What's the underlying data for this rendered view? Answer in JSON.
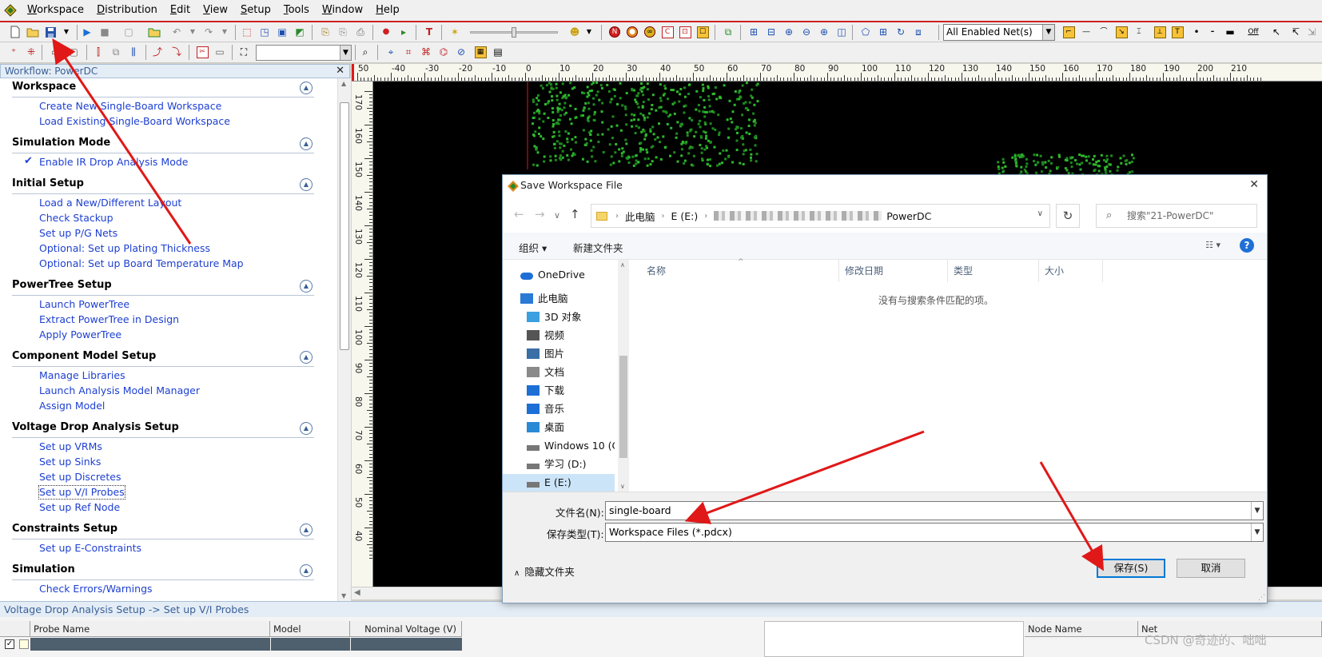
{
  "menubar": {
    "items": [
      {
        "label": "Workspace",
        "u": "W"
      },
      {
        "label": "Distribution",
        "u": "D"
      },
      {
        "label": "Edit",
        "u": "E"
      },
      {
        "label": "View",
        "u": "V"
      },
      {
        "label": "Setup",
        "u": "S"
      },
      {
        "label": "Tools",
        "u": "T"
      },
      {
        "label": "Window",
        "u": "W"
      },
      {
        "label": "Help",
        "u": "H"
      }
    ]
  },
  "toolbar": {
    "net_filter": "All Enabled Net(s)",
    "off_label": "Off"
  },
  "workflow": {
    "title": "Workflow: PowerDC",
    "sections": [
      {
        "title": "Workspace",
        "items": [
          {
            "label": "Create New Single-Board Workspace"
          },
          {
            "label": "Load Existing Single-Board Workspace"
          }
        ]
      },
      {
        "title": "Simulation Mode",
        "items": [
          {
            "label": "Enable IR Drop Analysis Mode",
            "checked": "✔"
          }
        ]
      },
      {
        "title": "Initial Setup",
        "items": [
          {
            "label": "Load a New/Different Layout"
          },
          {
            "label": "Check Stackup"
          },
          {
            "label": "Set up P/G Nets"
          },
          {
            "label": "Optional: Set up Plating Thickness"
          },
          {
            "label": "Optional: Set up Board Temperature Map"
          }
        ]
      },
      {
        "title": "PowerTree Setup",
        "items": [
          {
            "label": "Launch PowerTree"
          },
          {
            "label": "Extract PowerTree in Design"
          },
          {
            "label": "Apply PowerTree"
          }
        ]
      },
      {
        "title": "Component Model Setup",
        "items": [
          {
            "label": "Manage Libraries"
          },
          {
            "label": "Launch Analysis Model Manager"
          },
          {
            "label": "Assign Model"
          }
        ]
      },
      {
        "title": "Voltage Drop Analysis Setup",
        "items": [
          {
            "label": "Set up VRMs"
          },
          {
            "label": "Set up Sinks"
          },
          {
            "label": "Set up Discretes"
          },
          {
            "label": "Set up V/I Probes"
          },
          {
            "label": "Set up Ref Node"
          }
        ]
      },
      {
        "title": "Constraints Setup",
        "items": [
          {
            "label": "Set up E-Constraints"
          }
        ]
      },
      {
        "title": "Simulation",
        "items": [
          {
            "label": "Check Errors/Warnings"
          }
        ]
      }
    ]
  },
  "ruler": {
    "top_ticks": [
      "50",
      "-40",
      "-30",
      "-20",
      "-10",
      "0",
      "10",
      "20",
      "30",
      "40",
      "50",
      "60",
      "70",
      "80",
      "90",
      "100",
      "110",
      "120",
      "130",
      "140",
      "150",
      "160",
      "170",
      "180",
      "190",
      "200",
      "210"
    ],
    "left_ticks": [
      "170",
      "160",
      "150",
      "140",
      "130",
      "120",
      "110",
      "100",
      "90",
      "80",
      "70",
      "60",
      "50",
      "40"
    ]
  },
  "status_path": "Voltage Drop Analysis Setup -> Set up V/I Probes",
  "bottom_table": {
    "left_headers": [
      "Probe Name",
      "Model",
      "Nominal Voltage (V)"
    ],
    "right_headers": [
      "Node Name",
      "Net"
    ]
  },
  "dialog": {
    "title": "Save Workspace File",
    "breadcrumb": [
      "此电脑",
      "E (E:)",
      "PowerDC"
    ],
    "search_placeholder": "搜索\"21-PowerDC\"",
    "organize": "组织 ▾",
    "new_folder": "新建文件夹",
    "columns": [
      "名称",
      "修改日期",
      "类型",
      "大小"
    ],
    "empty_message": "没有与搜索条件匹配的项。",
    "tree": [
      {
        "label": "OneDrive",
        "icon": "onedrive-icon"
      },
      {
        "label": "此电脑",
        "icon": "computer-icon"
      },
      {
        "label": "3D 对象",
        "icon": "3d-objects-icon"
      },
      {
        "label": "视频",
        "icon": "video-icon"
      },
      {
        "label": "图片",
        "icon": "pictures-icon"
      },
      {
        "label": "文档",
        "icon": "documents-icon"
      },
      {
        "label": "下载",
        "icon": "download-icon"
      },
      {
        "label": "音乐",
        "icon": "music-icon"
      },
      {
        "label": "桌面",
        "icon": "desktop-icon"
      },
      {
        "label": "Windows 10 (C",
        "icon": "drive-icon"
      },
      {
        "label": "学习 (D:)",
        "icon": "drive-icon"
      },
      {
        "label": "E (E:)",
        "icon": "drive-icon"
      }
    ],
    "filename_label": "文件名(N):",
    "filename_value": "single-board",
    "filetype_label": "保存类型(T):",
    "filetype_value": "Workspace Files (*.pdcx)",
    "hide_folders": "隐藏文件夹",
    "save_button": "保存(S)",
    "cancel_button": "取消"
  },
  "watermark": "CSDN @奇迹的、咄咄"
}
